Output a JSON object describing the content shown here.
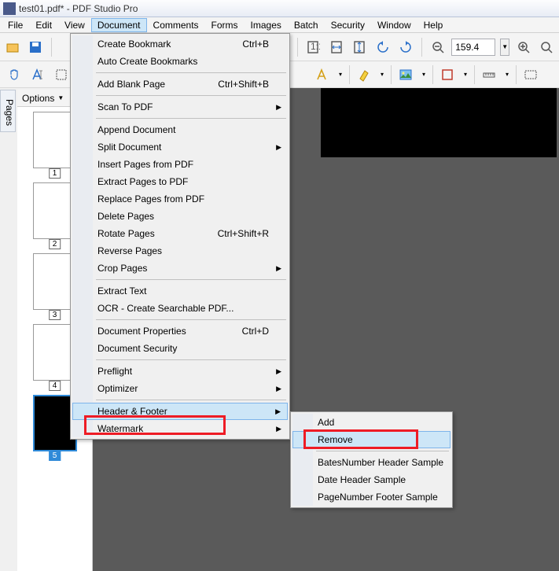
{
  "title": "test01.pdf* - PDF Studio Pro",
  "menubar": [
    "File",
    "Edit",
    "View",
    "Document",
    "Comments",
    "Forms",
    "Images",
    "Batch",
    "Security",
    "Window",
    "Help"
  ],
  "menubar_open_index": 3,
  "zoom": "159.4",
  "options_label": "Options",
  "pages_label": "Pages",
  "thumbs": [
    {
      "n": "1"
    },
    {
      "n": "2"
    },
    {
      "n": "3"
    },
    {
      "n": "4"
    },
    {
      "n": "5",
      "selected": true
    }
  ],
  "doc_menu": [
    {
      "label": "Create Bookmark",
      "shortcut": "Ctrl+B",
      "icon": "bookmark"
    },
    {
      "label": "Auto Create Bookmarks"
    },
    {
      "sep": true
    },
    {
      "label": "Add Blank Page",
      "shortcut": "Ctrl+Shift+B"
    },
    {
      "sep": true
    },
    {
      "label": "Scan To PDF",
      "submenu": true,
      "icon": "scan"
    },
    {
      "sep": true
    },
    {
      "label": "Append Document"
    },
    {
      "label": "Split Document",
      "submenu": true
    },
    {
      "label": "Insert Pages from PDF"
    },
    {
      "label": "Extract Pages to PDF"
    },
    {
      "label": "Replace Pages from PDF"
    },
    {
      "label": "Delete Pages"
    },
    {
      "label": "Rotate Pages",
      "shortcut": "Ctrl+Shift+R"
    },
    {
      "label": "Reverse Pages"
    },
    {
      "label": "Crop Pages",
      "submenu": true,
      "icon": "crop"
    },
    {
      "sep": true
    },
    {
      "label": "Extract Text"
    },
    {
      "label": "OCR - Create Searchable PDF..."
    },
    {
      "sep": true
    },
    {
      "label": "Document Properties",
      "shortcut": "Ctrl+D"
    },
    {
      "label": "Document Security",
      "icon": "lock"
    },
    {
      "sep": true
    },
    {
      "label": "Preflight",
      "submenu": true
    },
    {
      "label": "Optimizer",
      "submenu": true
    },
    {
      "sep": true
    },
    {
      "label": "Header & Footer",
      "submenu": true,
      "highlight": true
    },
    {
      "label": "Watermark",
      "submenu": true
    }
  ],
  "submenu": [
    {
      "label": "Add"
    },
    {
      "label": "Remove",
      "highlight": true,
      "hover": true
    },
    {
      "sep": true
    },
    {
      "label": "BatesNumber Header Sample"
    },
    {
      "label": "Date Header Sample"
    },
    {
      "label": "PageNumber Footer Sample"
    }
  ]
}
